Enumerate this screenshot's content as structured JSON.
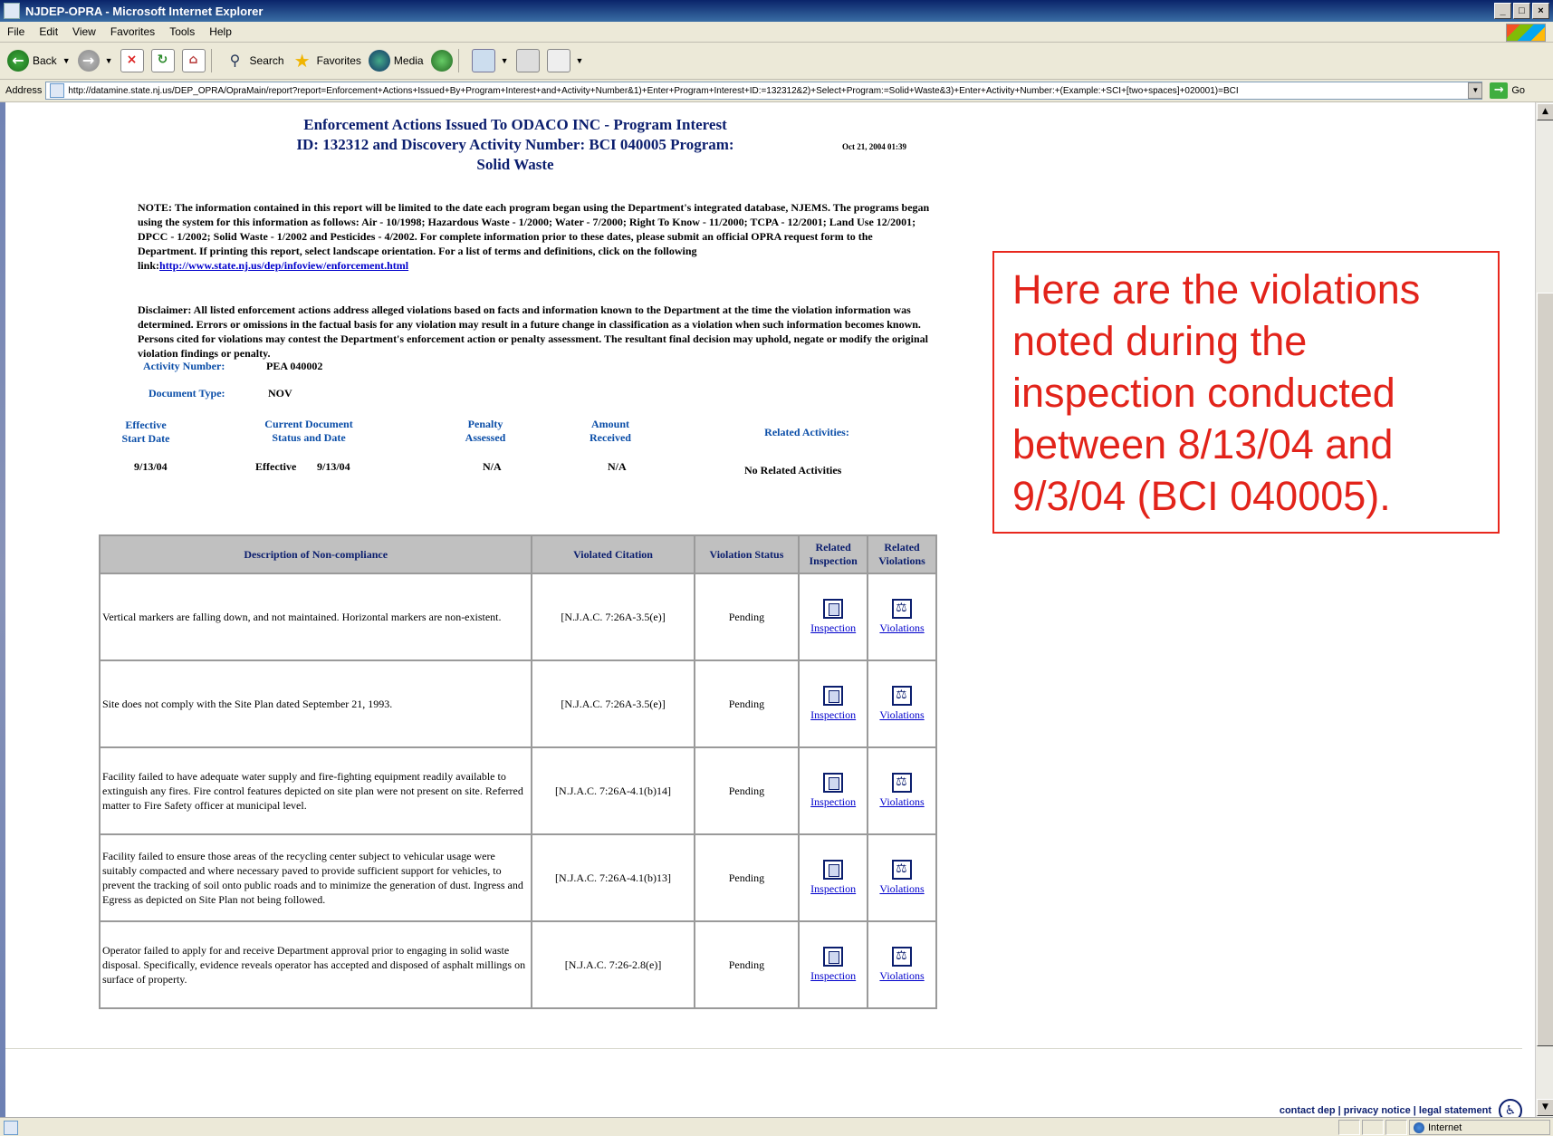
{
  "window": {
    "title": "NJDEP-OPRA - Microsoft Internet Explorer",
    "controls": [
      "_",
      "□",
      "×"
    ]
  },
  "menu": [
    "File",
    "Edit",
    "View",
    "Favorites",
    "Tools",
    "Help"
  ],
  "toolbar": {
    "back": "Back",
    "search": "Search",
    "favorites": "Favorites",
    "media": "Media"
  },
  "address": {
    "label": "Address",
    "url": "http://datamine.state.nj.us/DEP_OPRA/OpraMain/report?report=Enforcement+Actions+Issued+By+Program+Interest+and+Activity+Number&1)+Enter+Program+Interest+ID:=132312&2)+Select+Program:=Solid+Waste&3)+Enter+Activity+Number:+(Example:+SCI+[two+spaces]+020001)=BCI",
    "go": "Go"
  },
  "report": {
    "title_line1": "Enforcement Actions Issued To ODACO INC  - Program Interest",
    "title_line2": "ID:  132312  and Discovery Activity Number:  BCI  040005      Program:",
    "title_line3": "Solid Waste",
    "date": "Oct 21, 2004 01:39",
    "note_text": "NOTE: The information contained in this report will be limited to the date each program began using the Department's integrated database, NJEMS.  The programs began using the system for this information as follows: Air - 10/1998; Hazardous Waste - 1/2000; Water - 7/2000; Right To Know - 11/2000; TCPA - 12/2001; Land Use 12/2001; DPCC - 1/2002; Solid Waste - 1/2002 and Pesticides - 4/2002.  For complete information prior to these dates, please submit an official OPRA request form to the Department.  If printing this report, select landscape orientation.  For a list of terms and definitions, click on the following link:",
    "note_link": "http://www.state.nj.us/dep/infoview/enforcement.html",
    "disclaimer": "Disclaimer: All listed enforcement actions address alleged violations based on facts and information known to the Department at the time the violation information was determined. Errors or omissions in the factual basis for any violation may result in a future change in classification as a violation when such information becomes known. Persons cited for violations may contest the Department's enforcement action or penalty assessment. The resultant final decision may uphold, negate or modify the original violation findings or penalty.",
    "activity_number_label": "Activity Number:",
    "activity_number": "PEA  040002",
    "document_type_label": "Document Type:",
    "document_type": "NOV",
    "summary_headers": {
      "eff_1": "Effective",
      "eff_2": "Start Date",
      "cur_1": "Current Document",
      "cur_2": "Status and Date",
      "pen_1": "Penalty",
      "pen_2": "Assessed",
      "amt_1": "Amount",
      "amt_2": "Received",
      "rel": "Related Activities:"
    },
    "summary_values": {
      "start_date": "9/13/04",
      "status": "Effective",
      "status_date": "9/13/04",
      "penalty": "N/A",
      "amount": "N/A",
      "related": "No Related Activities"
    },
    "table_headers": {
      "desc": "Description of Non-compliance",
      "citation": "Violated Citation",
      "status": "Violation Status",
      "rel_insp_1": "Related",
      "rel_insp_2": "Inspection",
      "rel_vio_1": "Related",
      "rel_vio_2": "Violations"
    },
    "link_inspection": "Inspection",
    "link_violations": "Violations",
    "rows": [
      {
        "desc": "Vertical markers are falling down, and not maintained. Horizontal markers are non-existent.",
        "citation": "[N.J.A.C. 7:26A-3.5(e)]",
        "status": "Pending"
      },
      {
        "desc": "Site does not comply with the Site Plan dated September 21, 1993.",
        "citation": "[N.J.A.C. 7:26A-3.5(e)]",
        "status": "Pending"
      },
      {
        "desc": "Facility failed to have adequate water supply and fire-fighting equipment readily available to extinguish any fires. Fire control features depicted on site plan were not present on site. Referred matter to Fire Safety officer at municipal level.",
        "citation": "[N.J.A.C. 7:26A-4.1(b)14]",
        "status": "Pending"
      },
      {
        "desc": "Facility failed to ensure those areas of the recycling center subject to vehicular usage were suitably compacted and where necessary paved to provide sufficient support for vehicles, to prevent the tracking of soil onto public roads and to minimize the generation of dust. Ingress and Egress as depicted on Site Plan not being followed.",
        "citation": "[N.J.A.C. 7:26A-4.1(b)13]",
        "status": "Pending"
      },
      {
        "desc": "Operator failed to apply for and receive Department approval prior to engaging in solid waste disposal. Specifically, evidence reveals operator has accepted and disposed of asphalt millings on surface of property.",
        "citation": "[N.J.A.C. 7:26-2.8(e)]",
        "status": "Pending"
      }
    ]
  },
  "callout": "Here are the violations noted during the inspection conducted between 8/13/04 and 9/3/04 (BCI 040005).",
  "footer": {
    "links": "contact dep | privacy notice | legal statement"
  },
  "status": {
    "zone": "Internet"
  },
  "colors": {
    "callout": "#e2231a",
    "heading": "#0b1e6e",
    "label": "#0b4ea8"
  }
}
